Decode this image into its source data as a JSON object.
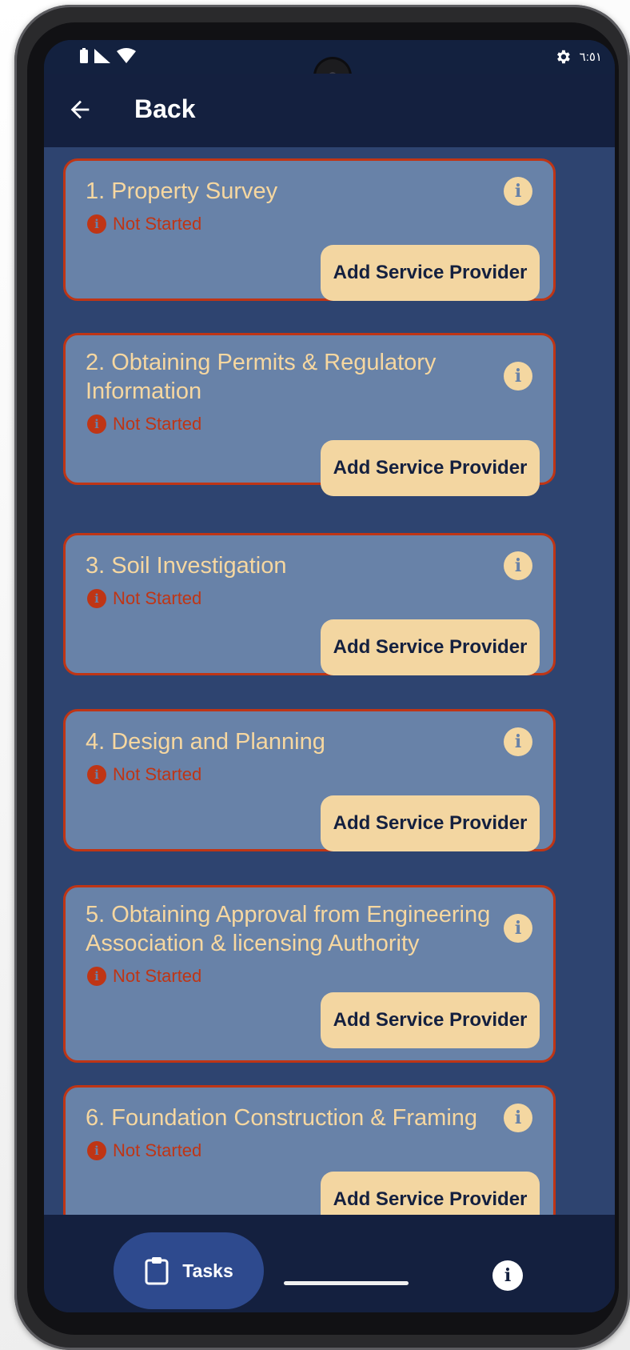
{
  "status_bar": {
    "time": "٦:٥١",
    "icons": [
      "battery-icon",
      "signal-icon",
      "wifi-icon",
      "gear-icon"
    ]
  },
  "app_bar": {
    "back_icon": "arrow-left-icon",
    "title": "Back"
  },
  "cards": [
    {
      "title": "1. Property Survey",
      "status": "Not Started",
      "button_label": "Add Service Provider"
    },
    {
      "title": "2. Obtaining Permits & Regulatory Information",
      "status": "Not Started",
      "button_label": "Add Service Provider"
    },
    {
      "title": "3. Soil Investigation",
      "status": "Not Started",
      "button_label": "Add Service Provider"
    },
    {
      "title": "4. Design and Planning",
      "status": "Not Started",
      "button_label": "Add Service Provider"
    },
    {
      "title": "5. Obtaining Approval from Engineering Association & licensing Authority",
      "status": "Not Started",
      "button_label": "Add Service Provider"
    },
    {
      "title": "6. Foundation Construction & Framing",
      "status": "Not Started",
      "button_label": "Add Service Provider"
    }
  ],
  "bottom_nav": {
    "tasks_label": "Tasks",
    "tasks_icon": "clipboard-icon",
    "info_icon": "info-icon"
  },
  "colors": {
    "background": "#14203f",
    "content": "#2e4470",
    "card": "#6882a8",
    "card_border": "#bf3515",
    "accent": "#f3d6a1",
    "status": "#bf3515"
  }
}
